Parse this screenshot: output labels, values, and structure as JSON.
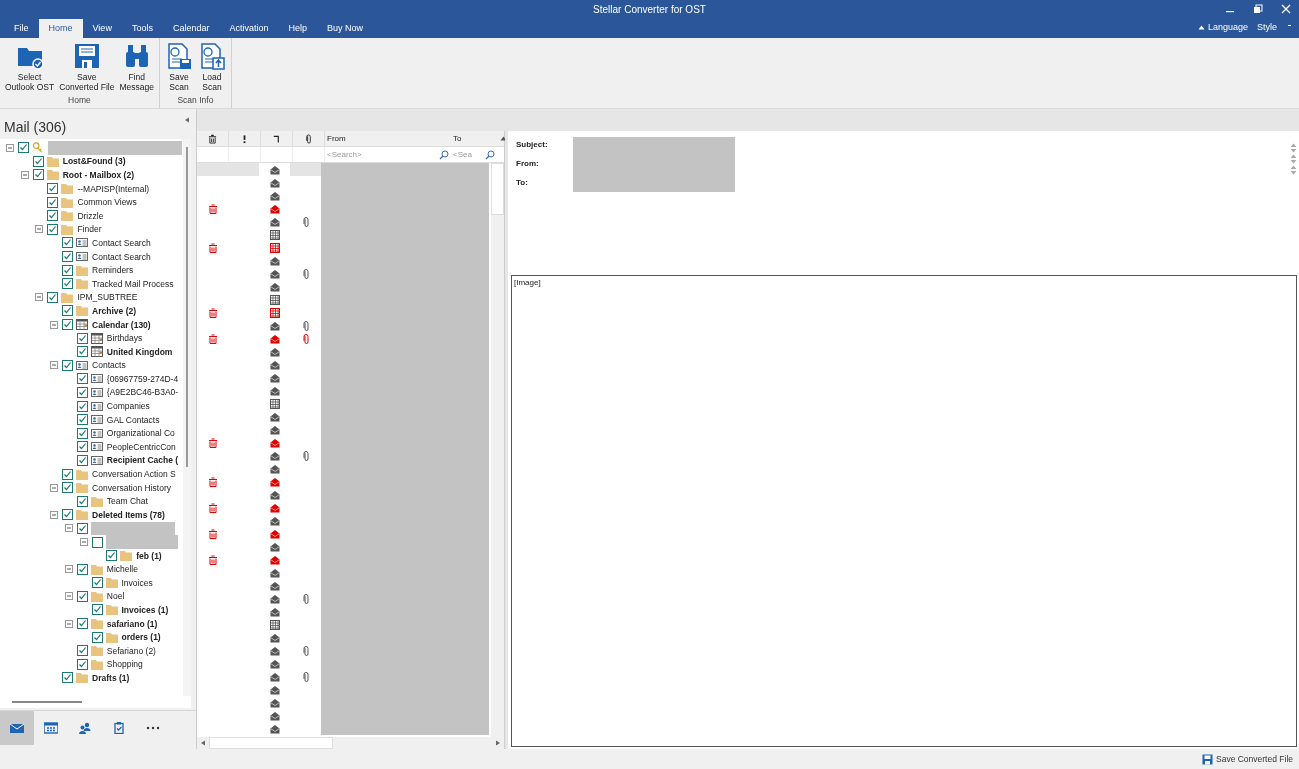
{
  "window": {
    "title": "Stellar Converter for OST"
  },
  "menu": {
    "tabs": [
      {
        "label": "File",
        "selected": false
      },
      {
        "label": "Home",
        "selected": true
      },
      {
        "label": "View",
        "selected": false
      },
      {
        "label": "Tools",
        "selected": false
      },
      {
        "label": "Calendar",
        "selected": false
      },
      {
        "label": "Activation",
        "selected": false
      },
      {
        "label": "Help",
        "selected": false
      },
      {
        "label": "Buy Now",
        "selected": false
      }
    ],
    "right": [
      {
        "label": "Language",
        "kind": "collapse"
      },
      {
        "label": "Style",
        "kind": "dropdown"
      }
    ]
  },
  "ribbon": {
    "groups": [
      {
        "label": "Home",
        "buttons": [
          {
            "label": "Select\nOutlook OST",
            "kind": "open-folder"
          },
          {
            "label": "Save\nConverted File",
            "kind": "save"
          },
          {
            "label": "Find\nMessage",
            "kind": "find"
          }
        ]
      },
      {
        "label": "Scan Info",
        "buttons": [
          {
            "label": "Save\nScan",
            "kind": "save-scan"
          },
          {
            "label": "Load\nScan",
            "kind": "load-scan"
          }
        ]
      }
    ]
  },
  "folder_pane": {
    "title": "Mail (306)",
    "tree": [
      {
        "redacted": true,
        "kind": "root",
        "checked": true,
        "expanded": true,
        "children": [
          {
            "label": "Lost&Found (3)",
            "kind": "folder",
            "checked": true,
            "unread": true
          },
          {
            "label": "Root - Mailbox (2)",
            "kind": "folder",
            "checked": true,
            "unread": true,
            "expanded": true,
            "children": [
              {
                "label": "--MAPISP(Internal)",
                "kind": "folder",
                "checked": true,
                "unread": false
              },
              {
                "label": "Common Views",
                "kind": "folder",
                "checked": true,
                "unread": false
              },
              {
                "label": "Drizzle",
                "kind": "folder",
                "checked": true,
                "unread": false
              },
              {
                "label": "Finder",
                "kind": "folder",
                "checked": true,
                "unread": false,
                "expanded": true,
                "children": [
                  {
                    "label": "Contact Search",
                    "kind": "contact",
                    "checked": true,
                    "unread": false
                  },
                  {
                    "label": "Contact Search",
                    "kind": "contact",
                    "checked": true,
                    "unread": false
                  },
                  {
                    "label": "Reminders",
                    "kind": "folder",
                    "checked": true,
                    "unread": false
                  },
                  {
                    "label": "Tracked Mail Process",
                    "kind": "folder",
                    "checked": true,
                    "unread": false
                  }
                ]
              },
              {
                "label": "IPM_SUBTREE",
                "kind": "folder",
                "checked": true,
                "unread": false,
                "expanded": true,
                "children": [
                  {
                    "label": "Archive (2)",
                    "kind": "folder",
                    "checked": true,
                    "unread": true
                  },
                  {
                    "label": "Calendar (130)",
                    "kind": "calendar",
                    "checked": true,
                    "unread": true,
                    "expanded": true,
                    "children": [
                      {
                        "label": "Birthdays",
                        "kind": "calendar",
                        "checked": true,
                        "unread": false
                      },
                      {
                        "label": "United Kingdom",
                        "kind": "calendar",
                        "checked": true,
                        "unread": true
                      }
                    ]
                  },
                  {
                    "label": "Contacts",
                    "kind": "contact",
                    "checked": true,
                    "unread": false,
                    "expanded": true,
                    "children": [
                      {
                        "label": "{06967759-274D-4",
                        "kind": "contact",
                        "checked": true,
                        "unread": false
                      },
                      {
                        "label": "{A9E2BC46-B3A0-",
                        "kind": "contact",
                        "checked": true,
                        "unread": false
                      },
                      {
                        "label": "Companies",
                        "kind": "contact",
                        "checked": true,
                        "unread": false
                      },
                      {
                        "label": "GAL Contacts",
                        "kind": "contact",
                        "checked": true,
                        "unread": false
                      },
                      {
                        "label": "Organizational Co",
                        "kind": "contact",
                        "checked": true,
                        "unread": false
                      },
                      {
                        "label": "PeopleCentricCon",
                        "kind": "contact",
                        "checked": true,
                        "unread": false
                      },
                      {
                        "label": "Recipient Cache (",
                        "kind": "contact",
                        "checked": true,
                        "unread": true
                      }
                    ]
                  },
                  {
                    "label": "Conversation Action S",
                    "kind": "folder",
                    "checked": true,
                    "unread": false
                  },
                  {
                    "label": "Conversation History",
                    "kind": "folder",
                    "checked": true,
                    "unread": false,
                    "expanded": true,
                    "children": [
                      {
                        "label": "Team Chat",
                        "kind": "folder",
                        "checked": true,
                        "unread": false
                      }
                    ]
                  },
                  {
                    "label": "Deleted Items (78)",
                    "kind": "folder",
                    "checked": true,
                    "unread": true,
                    "expanded": true,
                    "children": [
                      {
                        "redacted": true,
                        "kind": "none",
                        "checked": true,
                        "expanded": true,
                        "children": [
                          {
                            "redacted": true,
                            "kind": "none",
                            "checked": false,
                            "expanded": true,
                            "children": [
                              {
                                "label": "feb (1)",
                                "kind": "folder",
                                "checked": true,
                                "unread": true
                              }
                            ]
                          }
                        ]
                      },
                      {
                        "label": "Michelle",
                        "kind": "folder",
                        "checked": true,
                        "unread": false,
                        "expanded": true,
                        "children": [
                          {
                            "label": "Invoices",
                            "kind": "folder",
                            "checked": true,
                            "unread": false
                          }
                        ]
                      },
                      {
                        "label": "Noel",
                        "kind": "folder",
                        "checked": true,
                        "unread": false,
                        "expanded": true,
                        "children": [
                          {
                            "label": "Invoices (1)",
                            "kind": "folder",
                            "checked": true,
                            "unread": true
                          }
                        ]
                      },
                      {
                        "label": "safariano (1)",
                        "kind": "folder",
                        "checked": true,
                        "unread": true,
                        "expanded": true,
                        "children": [
                          {
                            "label": "orders (1)",
                            "kind": "folder",
                            "checked": true,
                            "unread": true
                          }
                        ]
                      },
                      {
                        "label": "Sefariano (2)",
                        "kind": "folder",
                        "checked": true,
                        "unread": false
                      },
                      {
                        "label": "Shopping",
                        "kind": "folder",
                        "checked": true,
                        "unread": false
                      }
                    ]
                  },
                  {
                    "label": "Drafts (1)",
                    "kind": "folder",
                    "checked": true,
                    "unread": true
                  }
                ]
              }
            ]
          }
        ]
      }
    ],
    "nav": [
      {
        "kind": "mail",
        "selected": true
      },
      {
        "kind": "calendar",
        "selected": false
      },
      {
        "kind": "contacts",
        "selected": false
      },
      {
        "kind": "tasks",
        "selected": false
      },
      {
        "kind": "more",
        "selected": false
      }
    ]
  },
  "message_list": {
    "columns": [
      {
        "kind": "deleted"
      },
      {
        "kind": "importance"
      },
      {
        "kind": "type"
      },
      {
        "kind": "attachment"
      },
      {
        "kind": "text",
        "label": "From",
        "placeholder": "<Search>"
      },
      {
        "kind": "text",
        "label": "To",
        "placeholder": "<Sea"
      }
    ],
    "rows": [
      {
        "selected": true,
        "deleted": false,
        "kind": "mail",
        "attachment": false
      },
      {
        "selected": false,
        "deleted": false,
        "kind": "mail",
        "attachment": false
      },
      {
        "selected": false,
        "deleted": false,
        "kind": "mail",
        "attachment": false
      },
      {
        "selected": false,
        "deleted": true,
        "kind": "mail",
        "attachment": false
      },
      {
        "selected": false,
        "deleted": false,
        "kind": "mail",
        "attachment": true
      },
      {
        "selected": false,
        "deleted": false,
        "kind": "calendar",
        "attachment": false
      },
      {
        "selected": false,
        "deleted": true,
        "kind": "calendar",
        "attachment": false
      },
      {
        "selected": false,
        "deleted": false,
        "kind": "mail",
        "attachment": false
      },
      {
        "selected": false,
        "deleted": false,
        "kind": "mail",
        "attachment": true
      },
      {
        "selected": false,
        "deleted": false,
        "kind": "mail",
        "attachment": false
      },
      {
        "selected": false,
        "deleted": false,
        "kind": "calendar",
        "attachment": false
      },
      {
        "selected": false,
        "deleted": true,
        "kind": "calendar",
        "attachment": false
      },
      {
        "selected": false,
        "deleted": false,
        "kind": "mail",
        "attachment": true
      },
      {
        "selected": false,
        "deleted": true,
        "kind": "mail",
        "attachment": true
      },
      {
        "selected": false,
        "deleted": false,
        "kind": "mail",
        "attachment": false
      },
      {
        "selected": false,
        "deleted": false,
        "kind": "mail",
        "attachment": false
      },
      {
        "selected": false,
        "deleted": false,
        "kind": "mail",
        "attachment": false
      },
      {
        "selected": false,
        "deleted": false,
        "kind": "mail",
        "attachment": false
      },
      {
        "selected": false,
        "deleted": false,
        "kind": "calendar",
        "attachment": false
      },
      {
        "selected": false,
        "deleted": false,
        "kind": "mail",
        "attachment": false
      },
      {
        "selected": false,
        "deleted": false,
        "kind": "mail",
        "attachment": false
      },
      {
        "selected": false,
        "deleted": true,
        "kind": "mail",
        "attachment": false
      },
      {
        "selected": false,
        "deleted": false,
        "kind": "mail",
        "attachment": true
      },
      {
        "selected": false,
        "deleted": false,
        "kind": "mail",
        "attachment": false
      },
      {
        "selected": false,
        "deleted": true,
        "kind": "mail",
        "attachment": false
      },
      {
        "selected": false,
        "deleted": false,
        "kind": "mail",
        "attachment": false
      },
      {
        "selected": false,
        "deleted": true,
        "kind": "mail",
        "attachment": false
      },
      {
        "selected": false,
        "deleted": false,
        "kind": "mail",
        "attachment": false
      },
      {
        "selected": false,
        "deleted": true,
        "kind": "mail",
        "attachment": false
      },
      {
        "selected": false,
        "deleted": false,
        "kind": "mail",
        "attachment": false
      },
      {
        "selected": false,
        "deleted": true,
        "kind": "mail",
        "attachment": false
      },
      {
        "selected": false,
        "deleted": false,
        "kind": "mail",
        "attachment": false
      },
      {
        "selected": false,
        "deleted": false,
        "kind": "mail",
        "attachment": false
      },
      {
        "selected": false,
        "deleted": false,
        "kind": "mail",
        "attachment": true
      },
      {
        "selected": false,
        "deleted": false,
        "kind": "mail",
        "attachment": false
      },
      {
        "selected": false,
        "deleted": false,
        "kind": "calendar",
        "attachment": false
      },
      {
        "selected": false,
        "deleted": false,
        "kind": "mail",
        "attachment": false
      },
      {
        "selected": false,
        "deleted": false,
        "kind": "mail",
        "attachment": true
      },
      {
        "selected": false,
        "deleted": false,
        "kind": "mail",
        "attachment": false
      },
      {
        "selected": false,
        "deleted": false,
        "kind": "mail",
        "attachment": true
      },
      {
        "selected": false,
        "deleted": false,
        "kind": "mail",
        "attachment": false
      },
      {
        "selected": false,
        "deleted": false,
        "kind": "mail",
        "attachment": false
      },
      {
        "selected": false,
        "deleted": false,
        "kind": "mail",
        "attachment": false
      },
      {
        "selected": false,
        "deleted": false,
        "kind": "mail",
        "attachment": false
      }
    ]
  },
  "preview": {
    "fields": [
      {
        "label": "Subject:"
      },
      {
        "label": "From:"
      },
      {
        "label": "To:"
      }
    ],
    "body": "[Image]"
  },
  "status_bar": {
    "action": "Save Converted File"
  }
}
